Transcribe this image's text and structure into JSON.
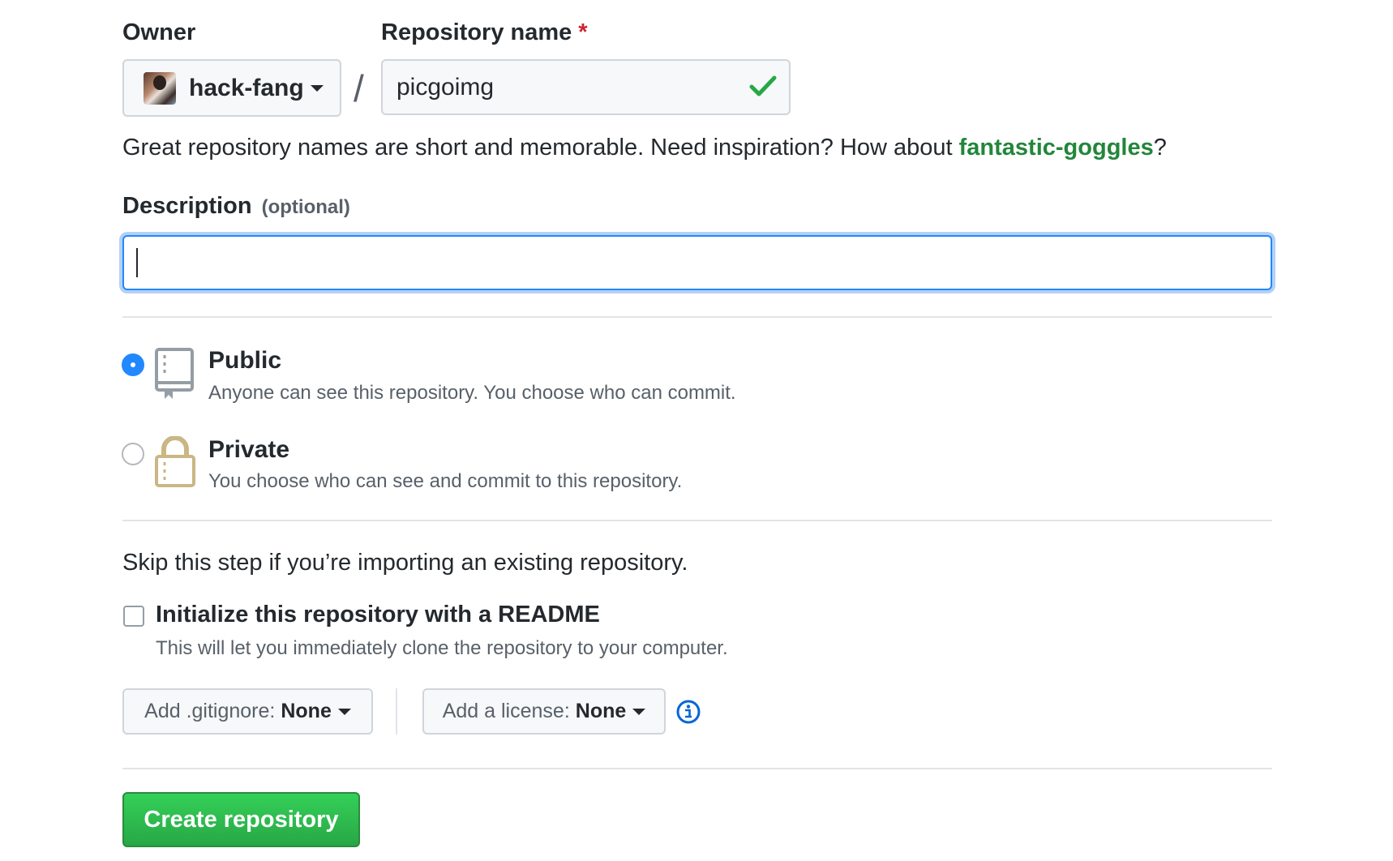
{
  "owner": {
    "label": "Owner",
    "selected": "hack-fang"
  },
  "repo_name": {
    "label": "Repository name",
    "required_marker": "*",
    "value": "picgoimg"
  },
  "hint": {
    "prefix": "Great repository names are short and memorable. Need inspiration? How about ",
    "suggestion": "fantastic-goggles",
    "suffix": "?"
  },
  "description": {
    "label": "Description",
    "optional": "(optional)",
    "value": ""
  },
  "visibility": {
    "selected": "public",
    "public": {
      "title": "Public",
      "desc": "Anyone can see this repository. You choose who can commit."
    },
    "private": {
      "title": "Private",
      "desc": "You choose who can see and commit to this repository."
    }
  },
  "init": {
    "skip_text": "Skip this step if you’re importing an existing repository.",
    "readme_title": "Initialize this repository with a README",
    "readme_desc": "This will let you immediately clone the repository to your computer.",
    "readme_checked": false,
    "gitignore_label": "Add .gitignore:",
    "gitignore_value": "None",
    "license_label": "Add a license:",
    "license_value": "None"
  },
  "submit_label": "Create repository",
  "colors": {
    "accent_blue": "#2188ff",
    "success_green": "#28a745",
    "suggestion_green": "#22863a",
    "required_red": "#cb2431"
  }
}
